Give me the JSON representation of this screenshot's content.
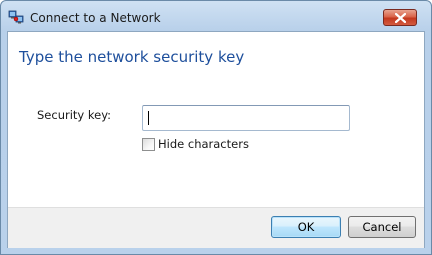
{
  "window": {
    "title": "Connect to a Network"
  },
  "dialog": {
    "heading": "Type the network security key",
    "security_key_label": "Security key:",
    "security_key_value": "",
    "hide_characters_label": "Hide characters",
    "hide_characters_checked": false
  },
  "buttons": {
    "ok_label": "OK",
    "cancel_label": "Cancel"
  },
  "icons": {
    "app": "network-connect-icon",
    "close": "close-icon"
  },
  "colors": {
    "heading": "#1e4f9c",
    "close_button": "#c3391f",
    "ok_button_border": "#3c7fb1"
  }
}
